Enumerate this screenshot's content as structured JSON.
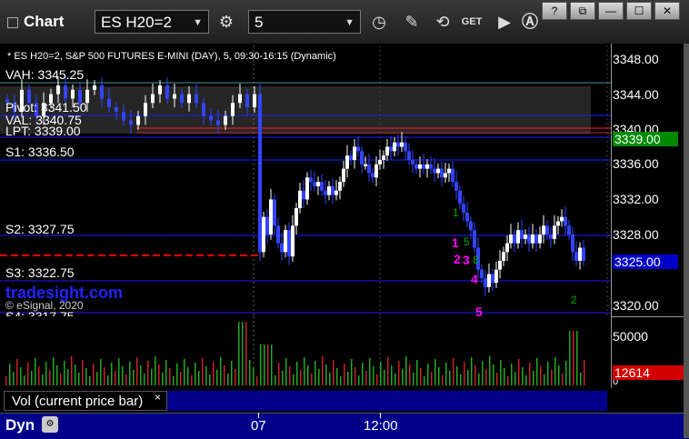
{
  "toolbar": {
    "title": "Chart",
    "symbol": "ES H20=2",
    "interval": "5",
    "window_buttons": [
      "?",
      "⧉",
      "—",
      "☐",
      "✕"
    ]
  },
  "chart": {
    "header": "* ES H20=2, S&P 500 FUTURES E-MINI (DAY), 5, 09:30-16:15 (Dynamic)",
    "price_ticks": [
      "3348.00",
      "3344.00",
      "3340.00",
      "3336.00",
      "3332.00",
      "3328.00",
      "3324.00",
      "3320.00"
    ],
    "last_price_line_label": "3339.00",
    "current_price_label": "3325.00",
    "level_labels": {
      "vah": "VAH: 3345.25",
      "pivot": "Pivot: 3341.50",
      "val": "VAL: 3340.75",
      "lpt": "LPT: 3339.00",
      "s1": "S1: 3336.50",
      "s2": "S2: 3327.75",
      "s3": "S3: 3322.75",
      "s4": "S4: 3317.75"
    },
    "watermark": "tradesight.com",
    "copyright": "© eSignal, 2020",
    "count_labels": [
      "1",
      "2",
      "3",
      "4",
      "5"
    ]
  },
  "volume": {
    "label": "Vol (current price bar)",
    "close": "×",
    "tick_top": "50000",
    "tick_bottom": "0",
    "current_value": "12614"
  },
  "time_axis": {
    "dyn": "Dyn",
    "ticks": [
      "07",
      "12:00"
    ]
  },
  "colors": {
    "up_bar": "#ffffff",
    "down_bar": "#3344ff",
    "level_line": "#1a1aff",
    "prior_close": "#ff0000",
    "badge_green": "#00a000",
    "badge_blue": "#0000cc"
  }
}
